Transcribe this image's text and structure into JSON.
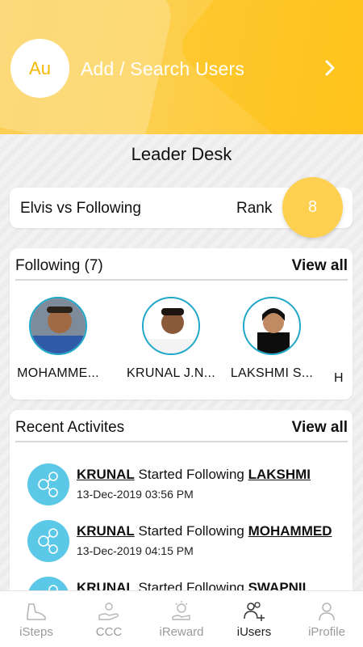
{
  "header": {
    "avatar_initials": "Au",
    "title": "Add / Search Users"
  },
  "desk": {
    "title": "Leader Desk"
  },
  "rank_card": {
    "label": "Elvis vs Following",
    "rank_word": "Rank",
    "rank_value": "8"
  },
  "following": {
    "title": "Following (7)",
    "view_all": "View all",
    "people": [
      {
        "name": "MOHAMME..."
      },
      {
        "name": "KRUNAL J.N..."
      },
      {
        "name": "LAKSHMI S..."
      },
      {
        "name": "H"
      }
    ]
  },
  "activities": {
    "title": "Recent Activites",
    "view_all": "View all",
    "items": [
      {
        "actor": "KRUNAL",
        "action": "Started Following",
        "target": "LAKSHMI",
        "time": "13-Dec-2019 03:56 PM"
      },
      {
        "actor": "KRUNAL",
        "action": "Started Following",
        "target": "MOHAMMED",
        "time": "13-Dec-2019 04:15 PM"
      },
      {
        "actor": "KRUNAL",
        "action": "Started Following",
        "target": "SWAPNIL",
        "time": ""
      }
    ]
  },
  "nav": {
    "items": [
      {
        "label": "iSteps",
        "icon": "shoe-icon"
      },
      {
        "label": "CCC",
        "icon": "hand-icon"
      },
      {
        "label": "iReward",
        "icon": "reward-icon"
      },
      {
        "label": "iUsers",
        "icon": "users-icon"
      },
      {
        "label": "iProfile",
        "icon": "profile-icon"
      }
    ],
    "active": "iUsers"
  },
  "colors": {
    "brand_yellow": "#fdd04f",
    "accent_blue": "#5bc8e8"
  }
}
